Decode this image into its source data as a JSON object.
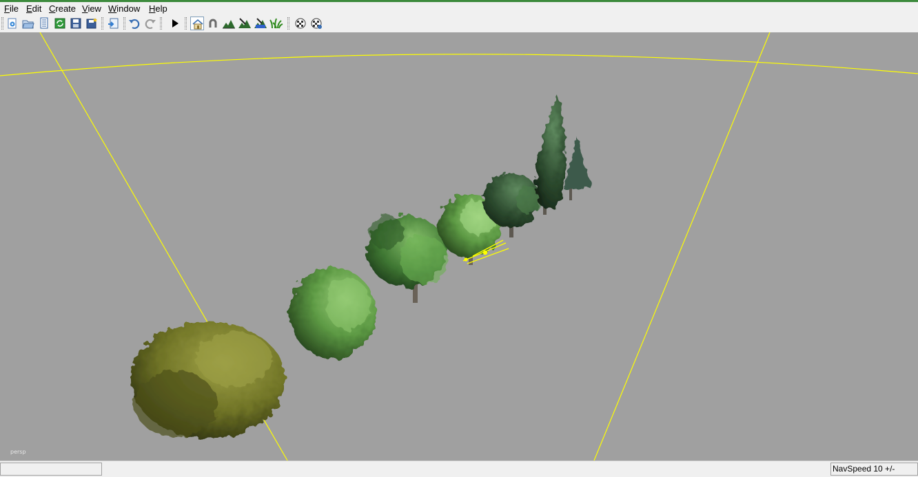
{
  "menu": {
    "file": "File",
    "edit": "Edit",
    "create": "Create",
    "view": "View",
    "window": "Window",
    "help": "Help"
  },
  "toolbar": {
    "icons": [
      "new-icon",
      "open-icon",
      "document-icon",
      "refresh-icon",
      "save-icon",
      "save-all-icon",
      "import-icon",
      "undo-icon",
      "redo-icon",
      "play-icon",
      "home-icon",
      "magnet-icon",
      "terrain-icon",
      "terrain-paint-icon",
      "terrain-water-icon",
      "grass-icon",
      "checker-icon",
      "checker-options-icon"
    ]
  },
  "viewport": {
    "camera_label": "persp",
    "background_color": "#a0a0a0",
    "frustum_color": "#ffff00"
  },
  "status": {
    "navspeed": "NavSpeed 10 +/-"
  }
}
